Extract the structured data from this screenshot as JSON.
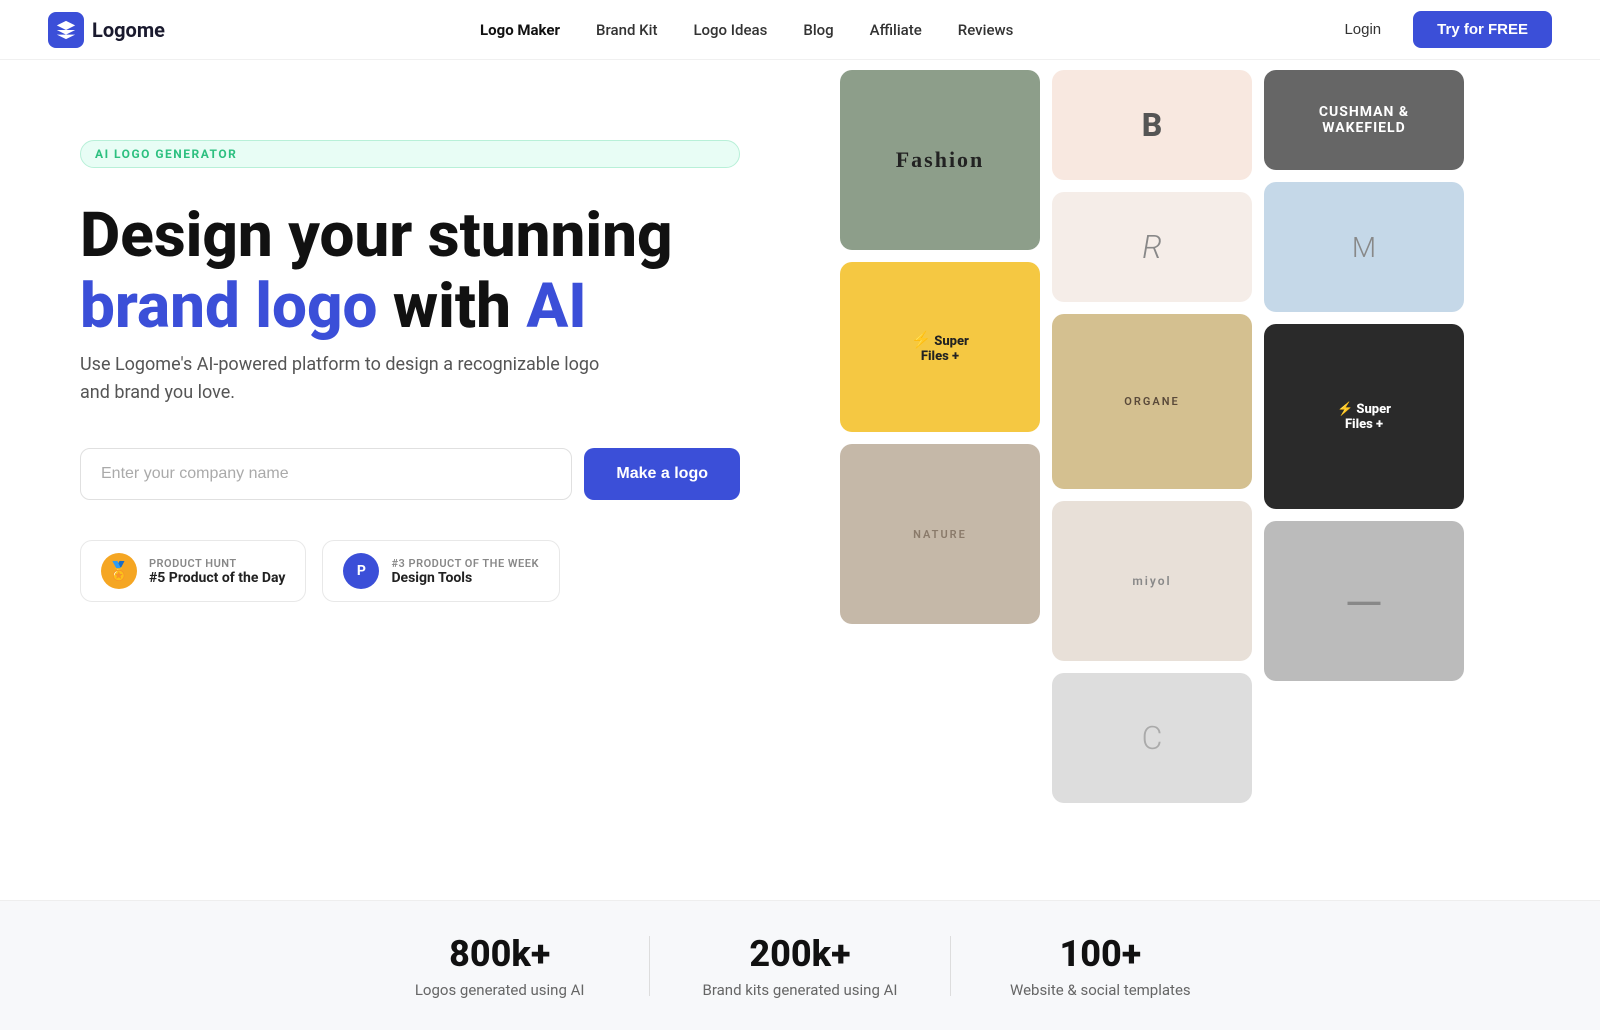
{
  "nav": {
    "logo_text": "Logome",
    "links": [
      {
        "label": "Logo Maker",
        "active": true
      },
      {
        "label": "Brand Kit",
        "active": false
      },
      {
        "label": "Logo Ideas",
        "active": false
      },
      {
        "label": "Blog",
        "active": false
      },
      {
        "label": "Affiliate",
        "active": false
      },
      {
        "label": "Reviews",
        "active": false
      }
    ],
    "login_label": "Login",
    "try_label": "Try for FREE"
  },
  "hero": {
    "badge_text": "AI LOGO GENERATOR",
    "title_line1": "Design your stunning",
    "title_blue": "brand logo",
    "title_with": "with",
    "title_ai": "AI",
    "subtitle": "Use Logome's AI-powered platform to design a recognizable logo and brand you love.",
    "input_placeholder": "Enter your company name",
    "cta_button": "Make a logo",
    "badge1_label": "PRODUCT HUNT",
    "badge1_text": "#5 Product of the Day",
    "badge2_label": "#3 PRODUCT OF THE WEEK",
    "badge2_text": "Design Tools"
  },
  "stats": [
    {
      "number": "800k+",
      "label": "Logos generated using AI"
    },
    {
      "number": "200k+",
      "label": "Brand kits generated using AI"
    },
    {
      "number": "100+",
      "label": "Website & social templates"
    }
  ]
}
